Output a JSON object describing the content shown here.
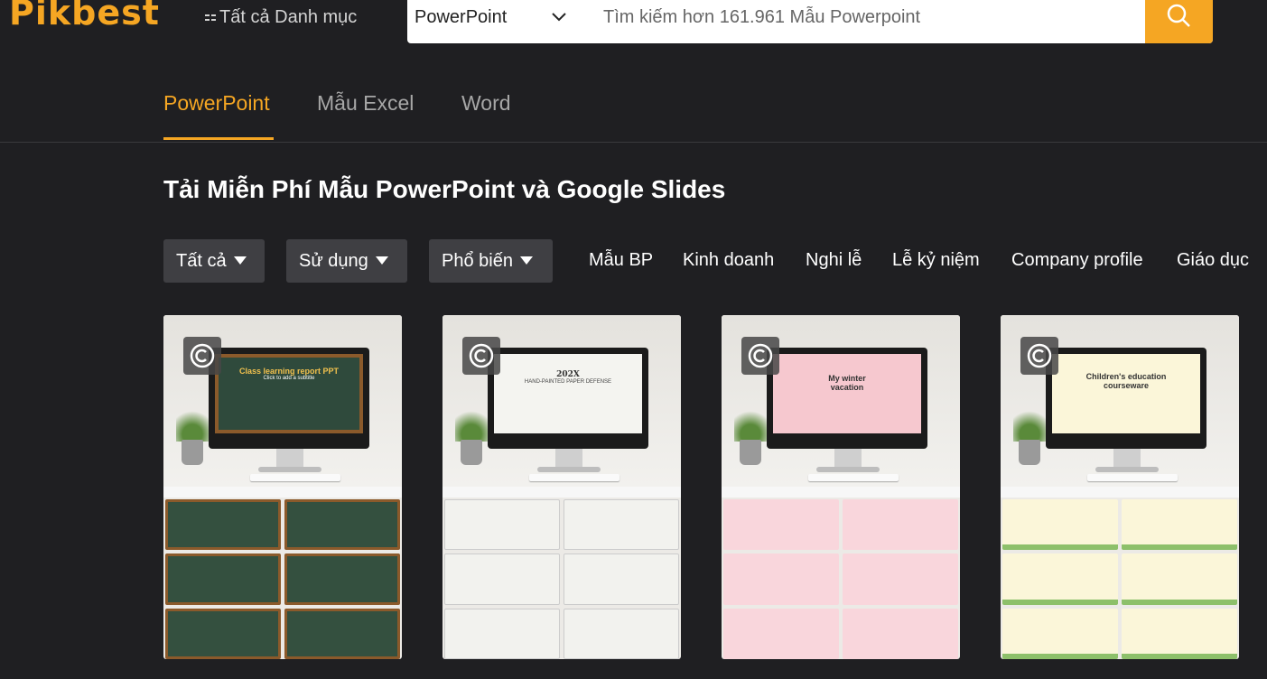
{
  "brand": {
    "logo_text": "Pikbest",
    "accent_color": "#f5a623"
  },
  "header": {
    "all_categories_label": "Tất cả Danh mục",
    "search": {
      "selected_type": "PowerPoint",
      "placeholder": "Tìm kiếm hơn 161.961 Mẫu Powerpoint",
      "button_icon": "search-icon"
    }
  },
  "tabs": [
    {
      "label": "PowerPoint",
      "active": true
    },
    {
      "label": "Mẫu Excel",
      "active": false
    },
    {
      "label": "Word",
      "active": false
    }
  ],
  "page_title": "Tải Miễn Phí Mẫu PowerPoint và Google Slides",
  "filters": [
    {
      "label": "Tất cả"
    },
    {
      "label": "Sử dụng"
    },
    {
      "label": "Phổ biến"
    }
  ],
  "categories": [
    "Mẫu BP",
    "Kinh doanh",
    "Nghi lễ",
    "Lễ kỷ niệm",
    "Company profile",
    "Giáo dục"
  ],
  "templates": [
    {
      "screen_text": "Class learning report PPT",
      "screen_subtext": "Click to add a subtitle",
      "copyright_icon": "copyright-icon"
    },
    {
      "screen_text": "202X",
      "screen_subtext": "HAND-PAINTED PAPER DEFENSE",
      "copyright_icon": "copyright-icon"
    },
    {
      "screen_text": "My winter vacation",
      "screen_subtext": "",
      "copyright_icon": "copyright-icon"
    },
    {
      "screen_text": "Children's education courseware",
      "screen_subtext": "",
      "copyright_icon": "copyright-icon"
    }
  ]
}
